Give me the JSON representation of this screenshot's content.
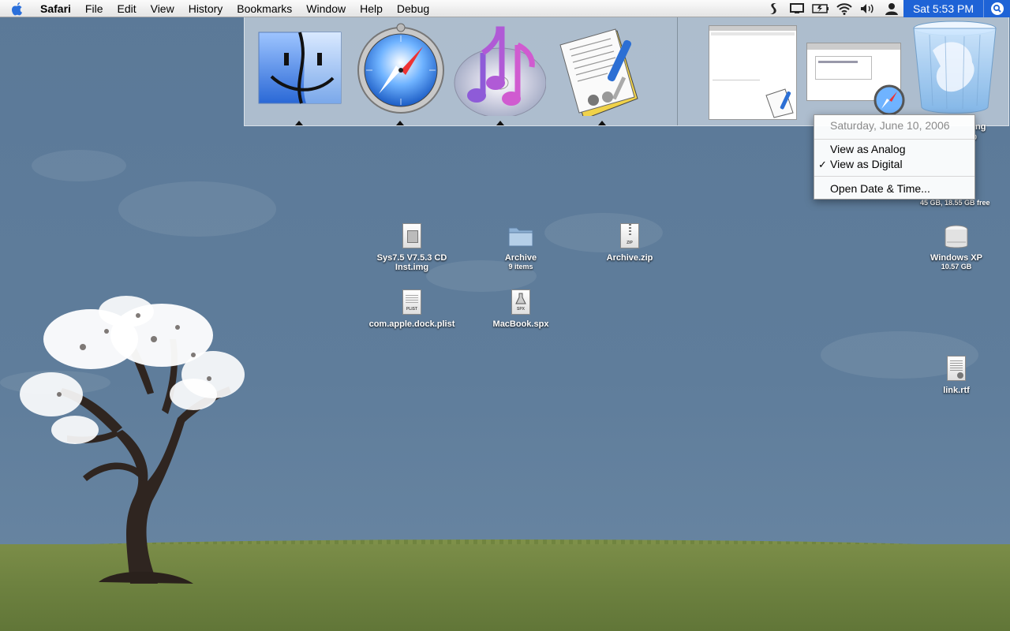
{
  "menubar": {
    "app_name": "Safari",
    "items": [
      "File",
      "Edit",
      "View",
      "History",
      "Bookmarks",
      "Window",
      "Help",
      "Debug"
    ],
    "clock": "Sat 5:53 PM"
  },
  "dock": {
    "apps": [
      {
        "name": "finder-icon"
      },
      {
        "name": "safari-icon"
      },
      {
        "name": "itunes-icon"
      },
      {
        "name": "textedit-icon"
      }
    ]
  },
  "clock_menu": {
    "date": "Saturday, June 10, 2006",
    "view_analog": "View as Analog",
    "view_digital": "View as Digital",
    "check_mark": "✓",
    "open_settings": "Open Date & Time..."
  },
  "desktop_icons": [
    {
      "name": "Sys7.5 V7.5.3 CD",
      "name2": "Inst.img",
      "sub": ""
    },
    {
      "name": "Archive",
      "name2": "",
      "sub": "9 items"
    },
    {
      "name": "Archive.zip",
      "name2": "",
      "sub": ""
    },
    {
      "name": "com.apple.dock.plist",
      "name2": "",
      "sub": ""
    },
    {
      "name": "MacBook.spx",
      "name2": "",
      "sub": ""
    },
    {
      "name": "Windows XP",
      "name2": "",
      "sub": "10.57 GB"
    },
    {
      "name": "link.rtf",
      "name2": "",
      "sub": ""
    }
  ],
  "partial_labels": {
    "drive_sub": "45 GB, 18.55 GB free",
    "peek1": "ng",
    "peek2": "0"
  },
  "icon_tags": {
    "zip": "ZIP",
    "plist": "PLIST",
    "spx": "SPX"
  },
  "colors": {
    "accent": "#1e63d6",
    "desktop": "#5d7a99",
    "grass": "#6e8240"
  }
}
